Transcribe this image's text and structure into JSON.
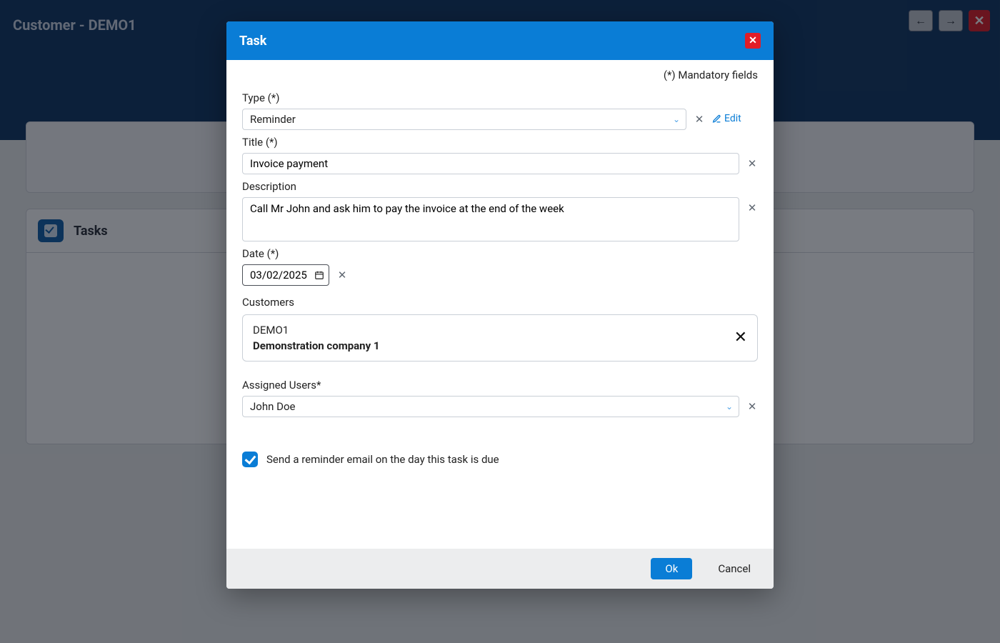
{
  "page": {
    "title": "Customer - DEMO1",
    "tasks_section_title": "Tasks"
  },
  "modal": {
    "title": "Task",
    "mandatory_note": "(*) Mandatory fields",
    "labels": {
      "type": "Type (*)",
      "title": "Title (*)",
      "description": "Description",
      "date": "Date (*)",
      "customers": "Customers",
      "assigned_users": "Assigned Users*"
    },
    "type_value": "Reminder",
    "edit_label": "Edit",
    "title_value": "Invoice payment",
    "description_value": "Call Mr John and ask him to pay the invoice at the end of the week",
    "date_value": "03/02/2025",
    "customer": {
      "code": "DEMO1",
      "name": "Demonstration company 1"
    },
    "assigned_user_value": "John Doe",
    "reminder_checkbox_label": "Send a reminder email on the day this task is due",
    "reminder_checked": true,
    "buttons": {
      "ok": "Ok",
      "cancel": "Cancel"
    }
  }
}
